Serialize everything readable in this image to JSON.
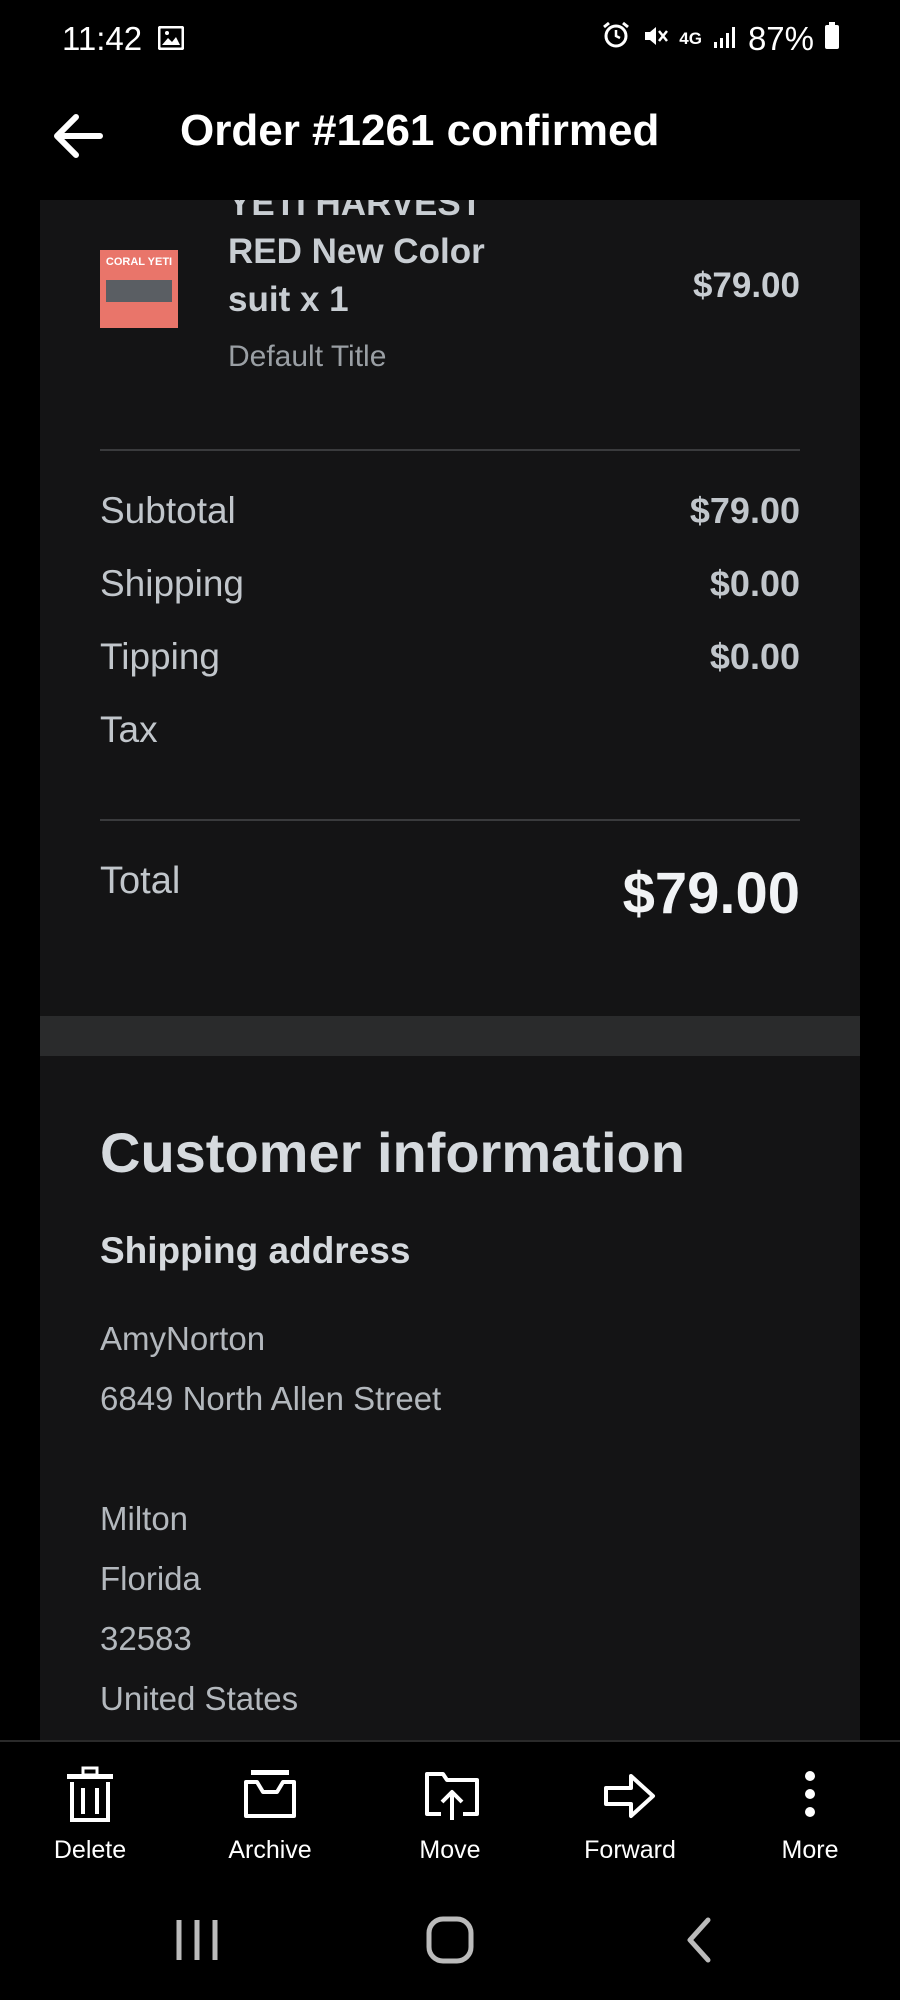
{
  "status_bar": {
    "time": "11:42",
    "network": "4G",
    "battery": "87%"
  },
  "header": {
    "title": "Order #1261 confirmed"
  },
  "order_item": {
    "name_line0": "YETI HARVEST",
    "name_line1": "RED New Color",
    "name_line2": "suit x 1",
    "variant": "Default Title",
    "price": "$79.00",
    "thumbnail_text": "CORAL YETI"
  },
  "summary": {
    "subtotal_label": "Subtotal",
    "subtotal_value": "$79.00",
    "shipping_label": "Shipping",
    "shipping_value": "$0.00",
    "tipping_label": "Tipping",
    "tipping_value": "$0.00",
    "tax_label": "Tax",
    "total_label": "Total",
    "total_value": "$79.00"
  },
  "customer": {
    "section_title": "Customer information",
    "shipping_title": "Shipping address",
    "name": "AmyNorton",
    "street": "6849 North Allen Street",
    "city": "Milton",
    "state": "Florida",
    "zip": "32583",
    "country": "United States"
  },
  "actions": [
    {
      "label": "Delete",
      "icon": "trash-icon"
    },
    {
      "label": "Archive",
      "icon": "archive-icon"
    },
    {
      "label": "Move",
      "icon": "move-icon"
    },
    {
      "label": "Forward",
      "icon": "forward-icon"
    },
    {
      "label": "More",
      "icon": "more-vertical-icon"
    }
  ],
  "colors": {
    "background": "#000000",
    "card": "#141415",
    "text": "#c1c6cb"
  }
}
